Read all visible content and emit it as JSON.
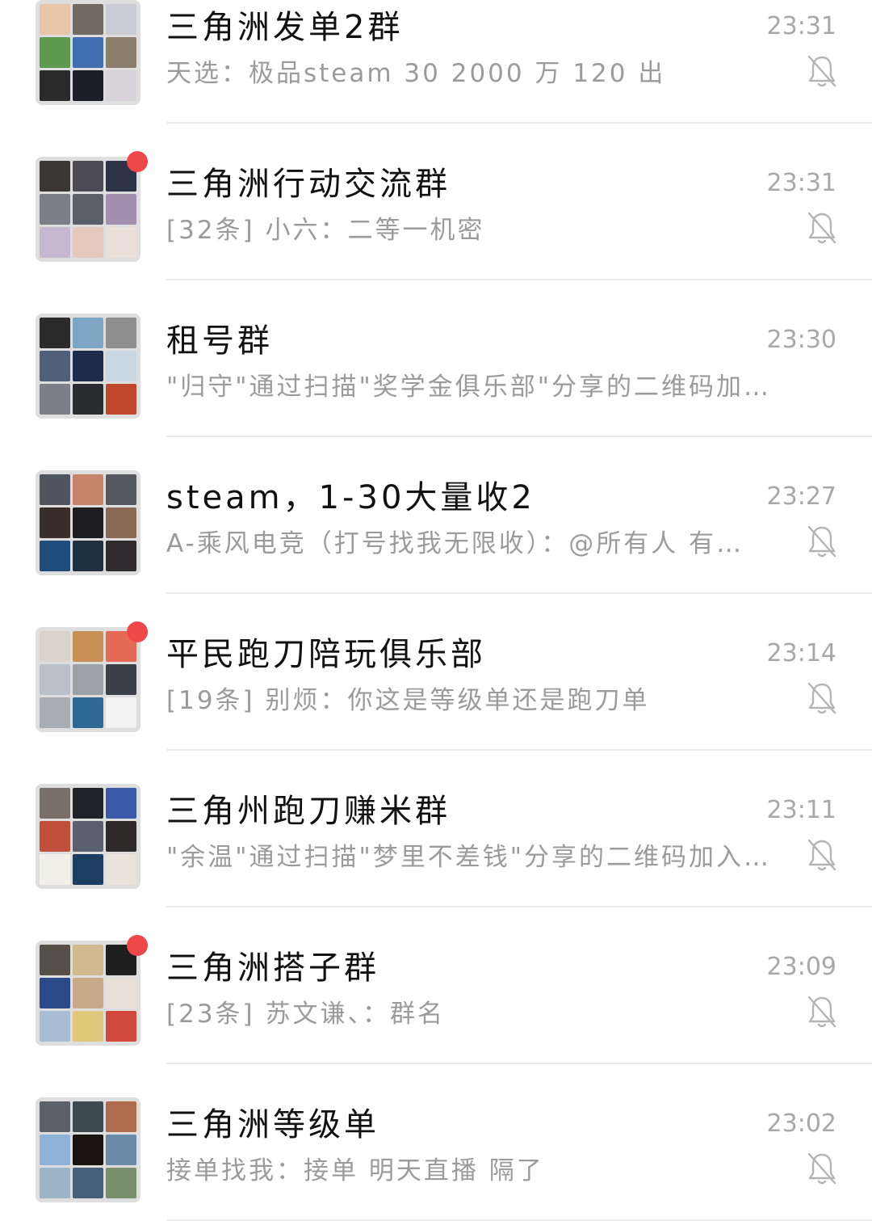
{
  "chats": [
    {
      "name": "三角洲发单2群",
      "time": "23:31",
      "preview": "天选：极品steam 30 2000 万 120 出",
      "unread": false,
      "muted": true,
      "tiles": [
        "#e9c6a8",
        "#6f6a62",
        "#c9ccd2",
        "#5d9a4e",
        "#3f6fb0",
        "#8b7e6a",
        "#2a2a2a",
        "#1c1f2a",
        "#d8d4d9"
      ]
    },
    {
      "name": "三角洲行动交流群",
      "time": "23:31",
      "preview": "[32条] 小六：二等一机密",
      "unread": true,
      "muted": true,
      "tiles": [
        "#3a3634",
        "#4c4a52",
        "#2d3246",
        "#7c8086",
        "#5a5f6a",
        "#a38fb0",
        "#c7b8cf",
        "#e6c8be",
        "#ecdedb"
      ]
    },
    {
      "name": "租号群",
      "time": "23:30",
      "preview": "\"归守\"通过扫描\"奖学金俱乐部\"分享的二维码加…",
      "unread": false,
      "muted": false,
      "tiles": [
        "#2b2b2b",
        "#7da6c4",
        "#8f8f8f",
        "#51607a",
        "#1d2b4e",
        "#c9d7e2",
        "#7c7f86",
        "#2a2c30",
        "#c0462c"
      ]
    },
    {
      "name": "steam，1-30大量收2",
      "time": "23:27",
      "preview": "A-乘风电竞（打号找我无限收）：@所有人 有…",
      "unread": false,
      "muted": true,
      "tiles": [
        "#4f5560",
        "#c7846a",
        "#55585d",
        "#3b2e2a",
        "#1d1d22",
        "#8a6a55",
        "#1f4c7a",
        "#1f3140",
        "#2f2b2e"
      ]
    },
    {
      "name": "平民跑刀陪玩俱乐部",
      "time": "23:14",
      "preview": "[19条] 别烦：你这是等级单还是跑刀单",
      "unread": true,
      "muted": true,
      "tiles": [
        "#d9d3cc",
        "#c98f55",
        "#e46a56",
        "#b9c0c8",
        "#9aa2a8",
        "#3b4048",
        "#a8adb3",
        "#2f6a96",
        "#f2f2f2"
      ]
    },
    {
      "name": "三角州跑刀赚米群",
      "time": "23:11",
      "preview": "\"余温\"通过扫描\"梦里不差钱\"分享的二维码加入…",
      "unread": false,
      "muted": true,
      "tiles": [
        "#7b6f6a",
        "#1f2226",
        "#3a5aa8",
        "#c0503c",
        "#5a6070",
        "#2e2a2a",
        "#f0f0e6",
        "#1c3e62",
        "#e8e3d9"
      ]
    },
    {
      "name": "三角洲搭子群",
      "time": "23:09",
      "preview": "[23条] 苏文谦、：群名",
      "unread": true,
      "muted": true,
      "tiles": [
        "#55504a",
        "#d2b88f",
        "#1e1e1e",
        "#2b4a8a",
        "#c8a887",
        "#e6e0d8",
        "#a8bcd4",
        "#e0c77a",
        "#d24a3c"
      ]
    },
    {
      "name": "三角洲等级单",
      "time": "23:02",
      "preview": "接单找我：接单 明天直播 隔了",
      "unread": false,
      "muted": true,
      "tiles": [
        "#5c6068",
        "#3d4a52",
        "#b06a4c",
        "#8fb2d8",
        "#1a1410",
        "#6b8ca8",
        "#9cb4c8",
        "#45617a",
        "#7a8f6c"
      ]
    }
  ]
}
